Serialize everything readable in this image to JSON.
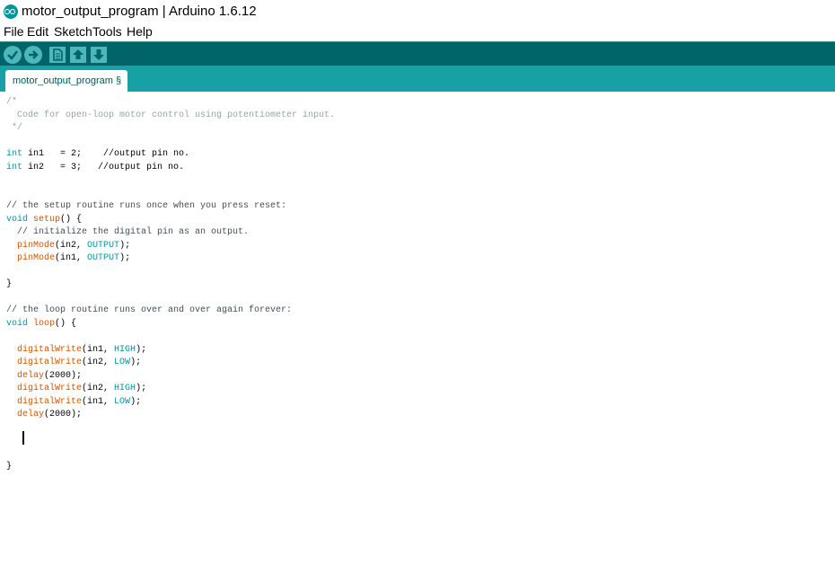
{
  "window": {
    "title": "motor_output_program | Arduino 1.6.12"
  },
  "menu": [
    "File",
    "Edit",
    "Sketch",
    "Tools",
    "Help"
  ],
  "toolbar": {
    "buttons": [
      {
        "name": "verify",
        "icon": "check-icon"
      },
      {
        "name": "upload",
        "icon": "arrow-right-icon"
      },
      {
        "name": "new",
        "icon": "file-icon"
      },
      {
        "name": "open",
        "icon": "arrow-up-icon"
      },
      {
        "name": "save",
        "icon": "arrow-down-icon"
      }
    ]
  },
  "tabs": [
    {
      "label": "motor_output_program §"
    }
  ],
  "colors": {
    "toolbar_bg": "#006468",
    "tabstrip_bg": "#17a1a5",
    "button_bg": "#4db7bb",
    "keyword": "#00979c",
    "function": "#d35400",
    "comment": "#95a5a6"
  },
  "code_lines": [
    [
      {
        "t": "/*",
        "c": "comment"
      }
    ],
    [
      {
        "t": "  Code for open-loop motor control using potentiometer input.",
        "c": "comment"
      }
    ],
    [
      {
        "t": " */",
        "c": "comment"
      }
    ],
    [],
    [
      {
        "t": "int",
        "c": "type"
      },
      {
        "t": " in1   = 2;    //output pin no.",
        "c": "plain"
      }
    ],
    [
      {
        "t": "int",
        "c": "type"
      },
      {
        "t": " in2   = 3;   //output pin no.",
        "c": "plain"
      }
    ],
    [],
    [],
    [
      {
        "t": "// the setup routine runs once when you press reset:",
        "c": "comment-dark"
      }
    ],
    [
      {
        "t": "void",
        "c": "type"
      },
      {
        "t": " ",
        "c": "plain"
      },
      {
        "t": "setup",
        "c": "func"
      },
      {
        "t": "() {",
        "c": "plain"
      }
    ],
    [
      {
        "t": "  // initialize the digital pin as an output.",
        "c": "comment-dark"
      }
    ],
    [
      {
        "t": "  ",
        "c": "plain"
      },
      {
        "t": "pinMode",
        "c": "func"
      },
      {
        "t": "(in2, ",
        "c": "plain"
      },
      {
        "t": "OUTPUT",
        "c": "const"
      },
      {
        "t": ");",
        "c": "plain"
      }
    ],
    [
      {
        "t": "  ",
        "c": "plain"
      },
      {
        "t": "pinMode",
        "c": "func"
      },
      {
        "t": "(in1, ",
        "c": "plain"
      },
      {
        "t": "OUTPUT",
        "c": "const"
      },
      {
        "t": ");",
        "c": "plain"
      }
    ],
    [],
    [
      {
        "t": "}",
        "c": "plain"
      }
    ],
    [],
    [
      {
        "t": "// the loop routine runs over and over again forever:",
        "c": "comment-dark"
      }
    ],
    [
      {
        "t": "void",
        "c": "type"
      },
      {
        "t": " ",
        "c": "plain"
      },
      {
        "t": "loop",
        "c": "func"
      },
      {
        "t": "() {",
        "c": "plain"
      }
    ],
    [],
    [
      {
        "t": "  ",
        "c": "plain"
      },
      {
        "t": "digitalWrite",
        "c": "func"
      },
      {
        "t": "(in1, ",
        "c": "plain"
      },
      {
        "t": "HIGH",
        "c": "const"
      },
      {
        "t": ");",
        "c": "plain"
      }
    ],
    [
      {
        "t": "  ",
        "c": "plain"
      },
      {
        "t": "digitalWrite",
        "c": "func"
      },
      {
        "t": "(in2, ",
        "c": "plain"
      },
      {
        "t": "LOW",
        "c": "const"
      },
      {
        "t": ");",
        "c": "plain"
      }
    ],
    [
      {
        "t": "  ",
        "c": "plain"
      },
      {
        "t": "delay",
        "c": "func"
      },
      {
        "t": "(2000);",
        "c": "plain"
      }
    ],
    [
      {
        "t": "  ",
        "c": "plain"
      },
      {
        "t": "digitalWrite",
        "c": "func"
      },
      {
        "t": "(in2, ",
        "c": "plain"
      },
      {
        "t": "HIGH",
        "c": "const"
      },
      {
        "t": ");",
        "c": "plain"
      }
    ],
    [
      {
        "t": "  ",
        "c": "plain"
      },
      {
        "t": "digitalWrite",
        "c": "func"
      },
      {
        "t": "(in1, ",
        "c": "plain"
      },
      {
        "t": "LOW",
        "c": "const"
      },
      {
        "t": ");",
        "c": "plain"
      }
    ],
    [
      {
        "t": "  ",
        "c": "plain"
      },
      {
        "t": "delay",
        "c": "func"
      },
      {
        "t": "(2000);",
        "c": "plain"
      }
    ],
    [],
    [],
    [],
    [
      {
        "t": "}",
        "c": "plain"
      }
    ]
  ]
}
